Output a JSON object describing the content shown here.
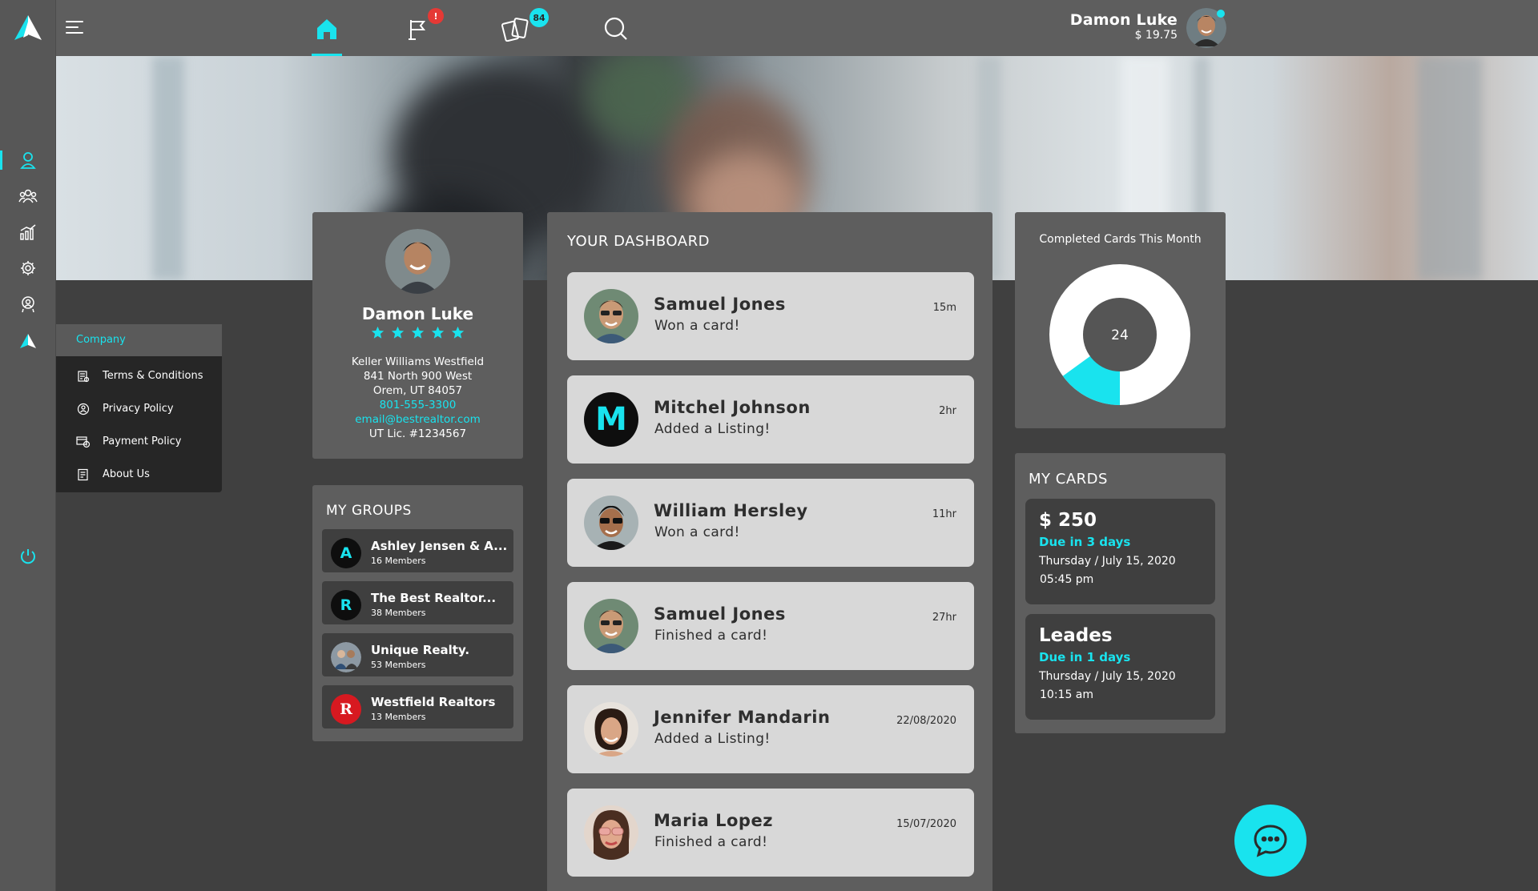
{
  "header": {
    "user_name": "Damon Luke",
    "balance": "$ 19.75",
    "flag_badge": "!",
    "cards_badge": "84"
  },
  "sidebar": {
    "icons": [
      "user-icon",
      "group-icon",
      "chart-icon",
      "gear-icon",
      "badge-icon",
      "logo-icon",
      "power-icon"
    ]
  },
  "company_menu": {
    "heading": "Company",
    "items": [
      {
        "label": "Terms & Conditions",
        "icon": "document-icon"
      },
      {
        "label": "Privacy Policy",
        "icon": "shield-icon"
      },
      {
        "label": "Payment Policy",
        "icon": "payment-icon"
      },
      {
        "label": "About Us",
        "icon": "info-doc-icon"
      }
    ]
  },
  "profile": {
    "name": "Damon Luke",
    "rating": 5,
    "company": "Keller Williams Westfield",
    "address1": "841 North 900 West",
    "address2": "Orem, UT 84057",
    "phone": "801-555-3300",
    "email": "email@bestrealtor.com",
    "license": "UT Lic. #1234567"
  },
  "groups": {
    "title": "MY GROUPS",
    "items": [
      {
        "name": "Ashley Jensen & A...",
        "members": "16 Members",
        "initial": "A"
      },
      {
        "name": "The Best Realtor...",
        "members": "38 Members",
        "initial": "R"
      },
      {
        "name": "Unique Realty.",
        "members": "53 Members",
        "initial": ""
      },
      {
        "name": "Westfield Realtors",
        "members": "13 Members",
        "initial": "R"
      }
    ]
  },
  "dashboard": {
    "title": "YOUR DASHBOARD",
    "feed": [
      {
        "name": "Samuel Jones",
        "action": "Won a card!",
        "time": "15m"
      },
      {
        "name": "Mitchel Johnson",
        "action": "Added a Listing!",
        "time": "2hr",
        "initial": "M"
      },
      {
        "name": "William Hersley",
        "action": "Won a card!",
        "time": "11hr"
      },
      {
        "name": "Samuel Jones",
        "action": "Finished a card!",
        "time": "27hr"
      },
      {
        "name": "Jennifer Mandarin",
        "action": "Added a Listing!",
        "time": "22/08/2020"
      },
      {
        "name": "Maria Lopez",
        "action": "Finished a card!",
        "time": "15/07/2020"
      }
    ]
  },
  "completed": {
    "title": "Completed Cards This Month",
    "value": "24",
    "fraction": 0.15,
    "colors": {
      "done": "#19e3ee",
      "rest": "#ffffff",
      "hole": "#555555"
    }
  },
  "my_cards": {
    "title": "MY CARDS",
    "items": [
      {
        "amount": "$ 250",
        "due": "Due in 3 days",
        "date": "Thursday / July 15, 2020",
        "time": "05:45 pm"
      },
      {
        "amount": "Leades",
        "due": "Due in 1 days",
        "date": "Thursday / July 15, 2020",
        "time": "10:15 am"
      }
    ]
  },
  "theme": {
    "accent": "#19e3ee",
    "panel": "#5e5e5e",
    "background": "#404040"
  }
}
